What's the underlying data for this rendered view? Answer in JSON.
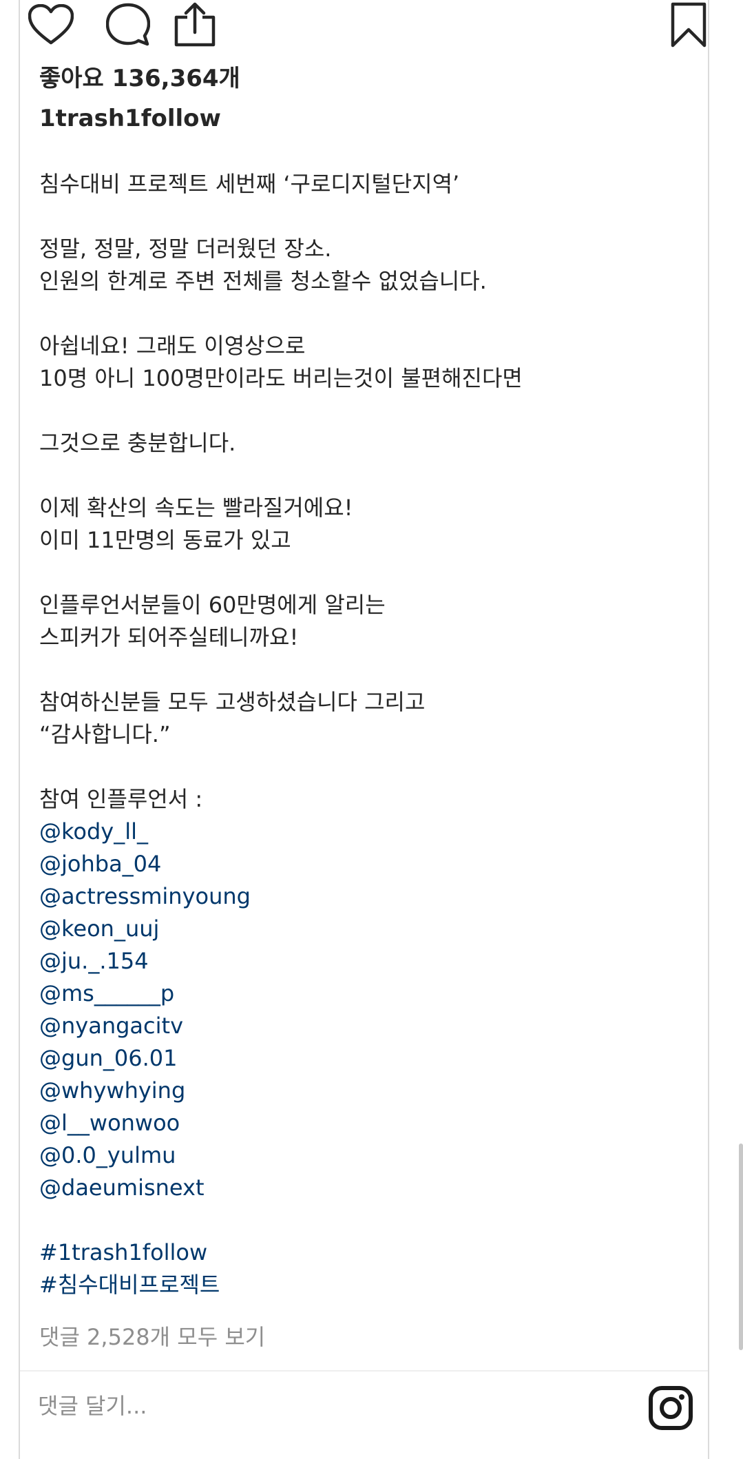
{
  "post": {
    "likes_text": "좋아요 136,364개",
    "username": "1trash1follow",
    "caption_blocks": [
      [
        "침수대비 프로젝트 세번째 ‘구로디지털단지역’"
      ],
      [
        "정말, 정말, 정말 더러웠던 장소.",
        "인원의 한계로 주변 전체를 청소할수 없었습니다."
      ],
      [
        "아쉽네요! 그래도 이영상으로",
        "10명 아니 100명만이라도 버리는것이 불편해진다면"
      ],
      [
        "그것으로 충분합니다."
      ],
      [
        "이제 확산의 속도는 빨라질거에요!",
        "이미 11만명의 동료가 있고"
      ],
      [
        "인플루언서분들이 60만명에게 알리는",
        "스피커가 되어주실테니까요!"
      ],
      [
        "참여하신분들 모두 고생하셨습니다 그리고",
        "“감사합니다.”"
      ]
    ],
    "influencer_label": "참여 인플루언서 :",
    "mentions": [
      "@kody_ll_",
      "@johba_04",
      "@actressminyoung",
      "@keon_uuj",
      "@ju._.154",
      "@ms______p",
      "@nyangacitv",
      "@gun_06.01",
      "@whywhying",
      "@l__wonwoo",
      "@0.0_yulmu",
      "@daeumisnext"
    ],
    "hashtags": [
      "#1trash1follow",
      "#침수대비프로젝트"
    ],
    "comments_link": "댓글 2,528개 모두 보기"
  },
  "actions": {
    "like_icon": "heart-icon",
    "comment_icon": "comment-bubble-icon",
    "share_icon": "share-icon",
    "save_icon": "bookmark-icon"
  },
  "comment_bar": {
    "placeholder": "댓글 달기...",
    "brand_icon": "instagram-icon"
  },
  "colors": {
    "text": "#262626",
    "link": "#00376b",
    "muted": "#8e8e8e",
    "border": "#dbdbdb"
  }
}
